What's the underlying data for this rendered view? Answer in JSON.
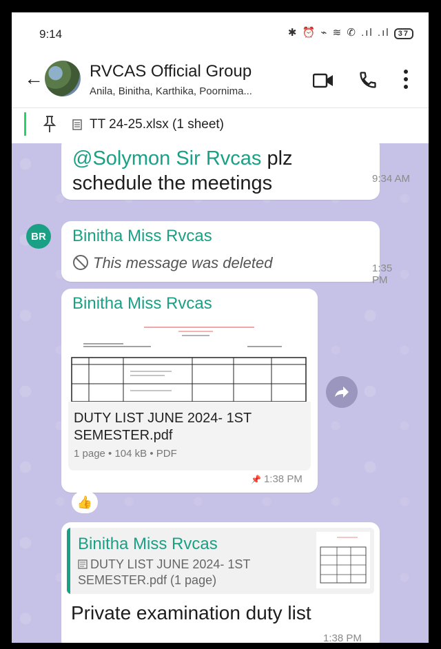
{
  "status_bar": {
    "time": "9:14",
    "icons": "✱ ⏰ ⌁ ≋ ✆ .ıl .ıl",
    "battery": "37"
  },
  "header": {
    "title": "RVCAS Official Group",
    "subtitle": "Anila, Binitha, Karthika, Poornima..."
  },
  "pinned": {
    "text": "TT 24-25.xlsx (1 sheet)"
  },
  "messages": [
    {
      "mention": "@Solymon Sir Rvcas",
      "text_after_mention": " plz",
      "text_line2": "schedule the meetings",
      "time": "9:34 AM"
    },
    {
      "avatar": "BR",
      "sender": "Binitha Miss Rvcas",
      "deleted_text": "This message was deleted",
      "time": "1:35 PM"
    },
    {
      "sender": "Binitha Miss Rvcas",
      "doc_name": "DUTY LIST JUNE 2024- 1ST SEMESTER.pdf",
      "doc_meta": "1 page • 104 kB • PDF",
      "time": "1:38 PM",
      "reaction": "👍"
    },
    {
      "quoted_sender": "Binitha Miss Rvcas",
      "quoted_text": "DUTY LIST JUNE 2024- 1ST SEMESTER.pdf (1 page)",
      "text": "Private examination duty list",
      "time": "1:38 PM"
    }
  ],
  "colors": {
    "accent": "#1aa085",
    "chat_bg": "#c6c1e6"
  }
}
